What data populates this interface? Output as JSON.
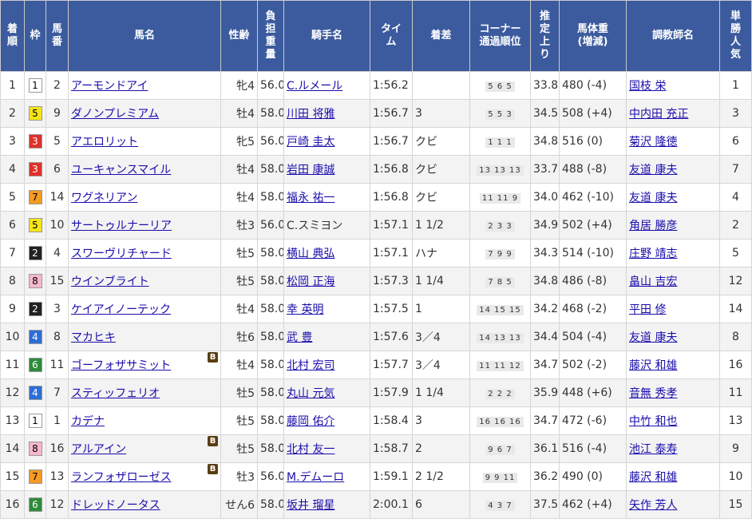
{
  "headers": {
    "rank": "着\n順",
    "waku": "枠",
    "umaban": "馬\n番",
    "name": "馬名",
    "sexage": "性齢",
    "weight": "負\n担\n重\n量",
    "jockey": "騎手名",
    "time": "タイ\nム",
    "margin": "着差",
    "corner": "コーナー\n通過順位",
    "last3f": "推\n定\n上\nり",
    "body": "馬体重\n(増減)",
    "trainer": "調教師名",
    "pop": "単\n勝\n人\n気"
  },
  "waku_colors": {
    "1": {
      "bg": "#ffffff",
      "fg": "#000000"
    },
    "2": {
      "bg": "#222222",
      "fg": "#ffffff"
    },
    "3": {
      "bg": "#e0302a",
      "fg": "#ffffff"
    },
    "4": {
      "bg": "#2d6ed6",
      "fg": "#ffffff"
    },
    "5": {
      "bg": "#f5e41a",
      "fg": "#000000"
    },
    "6": {
      "bg": "#2e8b3a",
      "fg": "#ffffff"
    },
    "7": {
      "bg": "#f59a22",
      "fg": "#000000"
    },
    "8": {
      "bg": "#f7b6cc",
      "fg": "#000000"
    }
  },
  "blinker_label": "B",
  "rows": [
    {
      "rank": "1",
      "waku": "1",
      "umaban": "2",
      "name": "アーモンドアイ",
      "blinker": false,
      "sexage": "牝4",
      "weight": "56.0",
      "jockey": "C.ルメール",
      "jockey_link": true,
      "time": "1:56.2",
      "margin": "",
      "corner": "5 6 5",
      "last3f": "33.8",
      "body": "480 (-4)",
      "trainer": "国枝 栄",
      "pop": "1"
    },
    {
      "rank": "2",
      "waku": "5",
      "umaban": "9",
      "name": "ダノンプレミアム",
      "blinker": false,
      "sexage": "牡4",
      "weight": "58.0",
      "jockey": "川田 将雅",
      "jockey_link": true,
      "time": "1:56.7",
      "margin": "3",
      "corner": "5 5 3",
      "last3f": "34.5",
      "body": "508 (+4)",
      "trainer": "中内田 充正",
      "pop": "3"
    },
    {
      "rank": "3",
      "waku": "3",
      "umaban": "5",
      "name": "アエロリット",
      "blinker": false,
      "sexage": "牝5",
      "weight": "56.0",
      "jockey": "戸崎 圭太",
      "jockey_link": true,
      "time": "1:56.7",
      "margin": "クビ",
      "corner": "1 1 1",
      "last3f": "34.8",
      "body": "516 (0)",
      "trainer": "菊沢 隆徳",
      "pop": "6"
    },
    {
      "rank": "4",
      "waku": "3",
      "umaban": "6",
      "name": "ユーキャンスマイル",
      "blinker": false,
      "sexage": "牡4",
      "weight": "58.0",
      "jockey": "岩田 康誠",
      "jockey_link": true,
      "time": "1:56.8",
      "margin": "クビ",
      "corner": "13 13 13",
      "last3f": "33.7",
      "body": "488 (-8)",
      "trainer": "友道 康夫",
      "pop": "7"
    },
    {
      "rank": "5",
      "waku": "7",
      "umaban": "14",
      "name": "ワグネリアン",
      "blinker": false,
      "sexage": "牡4",
      "weight": "58.0",
      "jockey": "福永 祐一",
      "jockey_link": true,
      "time": "1:56.8",
      "margin": "クビ",
      "corner": "11 11 9",
      "last3f": "34.0",
      "body": "462 (-10)",
      "trainer": "友道 康夫",
      "pop": "4"
    },
    {
      "rank": "6",
      "waku": "5",
      "umaban": "10",
      "name": "サートゥルナーリア",
      "blinker": false,
      "sexage": "牡3",
      "weight": "56.0",
      "jockey": "C.スミヨン",
      "jockey_link": false,
      "time": "1:57.1",
      "margin": "1 1/2",
      "corner": "2 3 3",
      "last3f": "34.9",
      "body": "502 (+4)",
      "trainer": "角居 勝彦",
      "pop": "2"
    },
    {
      "rank": "7",
      "waku": "2",
      "umaban": "4",
      "name": "スワーヴリチャード",
      "blinker": false,
      "sexage": "牡5",
      "weight": "58.0",
      "jockey": "横山 典弘",
      "jockey_link": true,
      "time": "1:57.1",
      "margin": "ハナ",
      "corner": "7 9 9",
      "last3f": "34.3",
      "body": "514 (-10)",
      "trainer": "庄野 靖志",
      "pop": "5"
    },
    {
      "rank": "8",
      "waku": "8",
      "umaban": "15",
      "name": "ウインブライト",
      "blinker": false,
      "sexage": "牡5",
      "weight": "58.0",
      "jockey": "松岡 正海",
      "jockey_link": true,
      "time": "1:57.3",
      "margin": "1 1/4",
      "corner": "7 8 5",
      "last3f": "34.8",
      "body": "486 (-8)",
      "trainer": "畠山 吉宏",
      "pop": "12"
    },
    {
      "rank": "9",
      "waku": "2",
      "umaban": "3",
      "name": "ケイアイノーテック",
      "blinker": false,
      "sexage": "牡4",
      "weight": "58.0",
      "jockey": "幸 英明",
      "jockey_link": true,
      "time": "1:57.5",
      "margin": "1",
      "corner": "14 15 15",
      "last3f": "34.2",
      "body": "468 (-2)",
      "trainer": "平田 修",
      "pop": "14"
    },
    {
      "rank": "10",
      "waku": "4",
      "umaban": "8",
      "name": "マカヒキ",
      "blinker": false,
      "sexage": "牡6",
      "weight": "58.0",
      "jockey": "武 豊",
      "jockey_link": true,
      "time": "1:57.6",
      "margin": "3／4",
      "corner": "14 13 13",
      "last3f": "34.4",
      "body": "504 (-4)",
      "trainer": "友道 康夫",
      "pop": "8"
    },
    {
      "rank": "11",
      "waku": "6",
      "umaban": "11",
      "name": "ゴーフォザサミット",
      "blinker": true,
      "sexage": "牡4",
      "weight": "58.0",
      "jockey": "北村 宏司",
      "jockey_link": true,
      "time": "1:57.7",
      "margin": "3／4",
      "corner": "11 11 12",
      "last3f": "34.7",
      "body": "502 (-2)",
      "trainer": "藤沢 和雄",
      "pop": "16"
    },
    {
      "rank": "12",
      "waku": "4",
      "umaban": "7",
      "name": "スティッフェリオ",
      "blinker": false,
      "sexage": "牡5",
      "weight": "58.0",
      "jockey": "丸山 元気",
      "jockey_link": true,
      "time": "1:57.9",
      "margin": "1 1/4",
      "corner": "2 2 2",
      "last3f": "35.9",
      "body": "448 (+6)",
      "trainer": "音無 秀孝",
      "pop": "11"
    },
    {
      "rank": "13",
      "waku": "1",
      "umaban": "1",
      "name": "カデナ",
      "blinker": false,
      "sexage": "牡5",
      "weight": "58.0",
      "jockey": "藤岡 佑介",
      "jockey_link": true,
      "time": "1:58.4",
      "margin": "3",
      "corner": "16 16 16",
      "last3f": "34.7",
      "body": "472 (-6)",
      "trainer": "中竹 和也",
      "pop": "13"
    },
    {
      "rank": "14",
      "waku": "8",
      "umaban": "16",
      "name": "アルアイン",
      "blinker": true,
      "sexage": "牡5",
      "weight": "58.0",
      "jockey": "北村 友一",
      "jockey_link": true,
      "time": "1:58.7",
      "margin": "2",
      "corner": "9 6 7",
      "last3f": "36.1",
      "body": "516 (-4)",
      "trainer": "池江 泰寿",
      "pop": "9"
    },
    {
      "rank": "15",
      "waku": "7",
      "umaban": "13",
      "name": "ランフォザローゼス",
      "blinker": true,
      "sexage": "牡3",
      "weight": "56.0",
      "jockey": "M.デムーロ",
      "jockey_link": true,
      "time": "1:59.1",
      "margin": "2 1/2",
      "corner": "9 9 11",
      "last3f": "36.2",
      "body": "490 (0)",
      "trainer": "藤沢 和雄",
      "pop": "10"
    },
    {
      "rank": "16",
      "waku": "6",
      "umaban": "12",
      "name": "ドレッドノータス",
      "blinker": false,
      "sexage": "せん6",
      "weight": "58.0",
      "jockey": "坂井 瑠星",
      "jockey_link": true,
      "time": "2:00.1",
      "margin": "6",
      "corner": "4 3 7",
      "last3f": "37.5",
      "body": "462 (+4)",
      "trainer": "矢作 芳人",
      "pop": "15"
    }
  ]
}
